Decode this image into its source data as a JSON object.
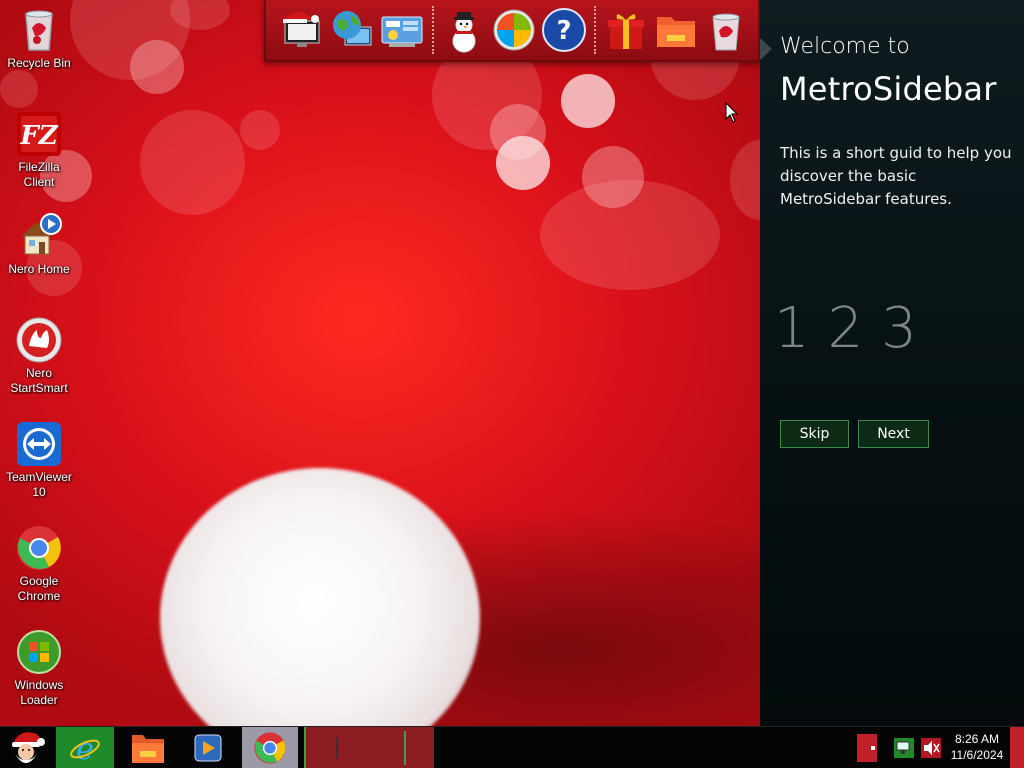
{
  "desktop": {
    "icons": [
      {
        "label": "Recycle Bin",
        "icon": "recycle-bin-icon"
      },
      {
        "label": "FileZilla Client",
        "icon": "filezilla-icon"
      },
      {
        "label": "Nero Home",
        "icon": "nero-home-icon"
      },
      {
        "label": "Nero StartSmart",
        "icon": "nero-startsmart-icon"
      },
      {
        "label": "TeamViewer 10",
        "icon": "teamviewer-icon"
      },
      {
        "label": "Google Chrome",
        "icon": "chrome-icon"
      },
      {
        "label": "Windows Loader",
        "icon": "windows-loader-icon"
      }
    ]
  },
  "dock": {
    "items": [
      {
        "icon": "christmas-computer-icon"
      },
      {
        "icon": "network-globe-icon"
      },
      {
        "icon": "control-panel-icon"
      },
      {
        "icon": "snowman-icon"
      },
      {
        "icon": "windows-orb-icon"
      },
      {
        "icon": "help-icon"
      },
      {
        "icon": "gift-icon"
      },
      {
        "icon": "folder-icon"
      },
      {
        "icon": "trash-icon"
      }
    ]
  },
  "sidebar": {
    "welcome_line1": "Welcome to",
    "welcome_line2": "MetroSidebar",
    "intro": "This is a short guid to help you discover the basic MetroSidebar features.",
    "steps": [
      "1",
      "2",
      "3"
    ],
    "skip_label": "Skip",
    "next_label": "Next"
  },
  "taskbar": {
    "start_icon": "santa-start-icon",
    "pinned": [
      {
        "icon": "internet-explorer-icon"
      },
      {
        "icon": "file-explorer-icon"
      },
      {
        "icon": "media-player-icon"
      },
      {
        "icon": "chrome-icon"
      }
    ],
    "clock_time": "8:26 AM",
    "clock_date": "11/6/2024"
  },
  "colors": {
    "wallpaper_red": "#d8101a",
    "sidebar_bg": "#061012",
    "button_border": "#3b8a4a",
    "taskbar_bg": "#050505"
  }
}
